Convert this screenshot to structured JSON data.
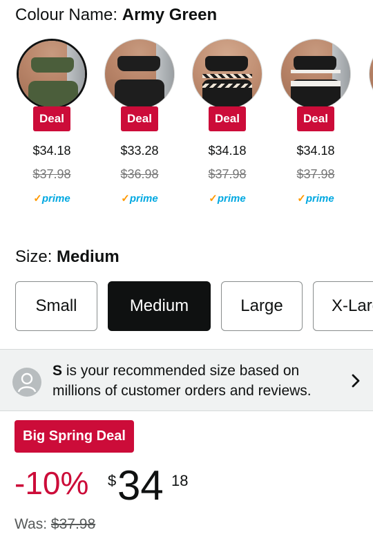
{
  "colour": {
    "label": "Colour Name:",
    "selected": "Army Green",
    "swatches": [
      {
        "name": "army-green",
        "deal": "Deal",
        "price": "$34.18",
        "was": "$37.98",
        "prime": "prime",
        "top_color": "#4b5e3b",
        "bottom_color": "#4b5e3b",
        "selected": true
      },
      {
        "name": "black",
        "deal": "Deal",
        "price": "$33.28",
        "was": "$36.98",
        "prime": "prime",
        "top_color": "#1e1e1e",
        "bottom_color": "#1e1e1e",
        "selected": false
      },
      {
        "name": "black-zigzag",
        "deal": "Deal",
        "price": "$34.18",
        "was": "$37.98",
        "prime": "prime",
        "top_color": "#1a1a1a",
        "bottom_color": "#1a1a1a",
        "selected": false
      },
      {
        "name": "black-white-band",
        "deal": "Deal",
        "price": "$34.18",
        "was": "$37.98",
        "prime": "prime",
        "top_color": "#1a1a1a",
        "bottom_color": "#1a1a1a",
        "selected": false
      }
    ]
  },
  "size": {
    "label": "Size:",
    "selected": "Medium",
    "options": [
      "Small",
      "Medium",
      "Large",
      "X-Large"
    ]
  },
  "recommendation": {
    "size": "S",
    "text": " is your recommended size based on millions of customer orders and reviews."
  },
  "pricing": {
    "badge": "Big Spring Deal",
    "discount": "-10%",
    "currency": "$",
    "whole": "34",
    "fraction": "18",
    "was_label": "Was:",
    "was_price": "$37.98"
  },
  "colors": {
    "deal_red": "#cc0c39",
    "prime_blue": "#00a8e1",
    "prime_check": "#ff9900"
  }
}
